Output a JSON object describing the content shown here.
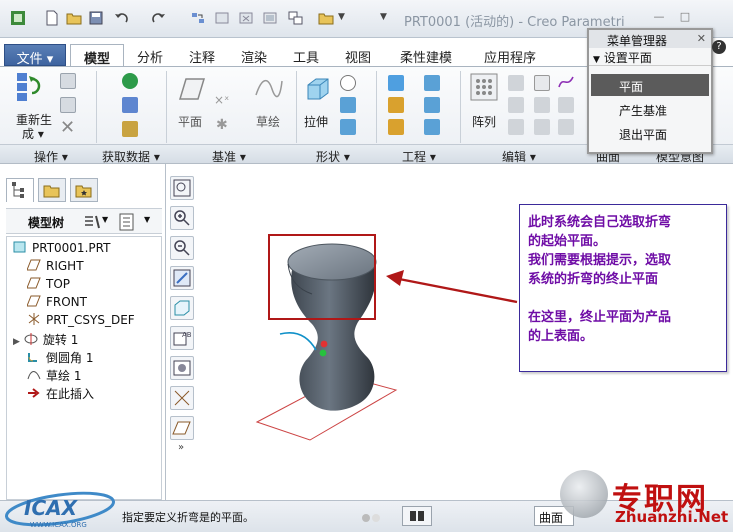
{
  "window": {
    "title": "PRT0001 (活动的) - Creo Parametri"
  },
  "tabs": [
    "文件 ▾",
    "模型",
    "分析",
    "注释",
    "渲染",
    "工具",
    "视图",
    "柔性建模",
    "应用程序"
  ],
  "ribbon": {
    "regen_label": "重新生",
    "regen_label2": "成 ▾",
    "plane_label": "平面",
    "sketch_label": "草绘",
    "extrude_label": "拉伸",
    "pattern_label": "阵列"
  },
  "groups": [
    "操作 ▾",
    "获取数据 ▾",
    "基准 ▾",
    "形状 ▾",
    "工程 ▾",
    "编辑 ▾",
    "曲面",
    "模型意图"
  ],
  "model_tree": {
    "header": "模型树",
    "items": [
      {
        "label": "PRT0001.PRT"
      },
      {
        "label": "RIGHT"
      },
      {
        "label": "TOP"
      },
      {
        "label": "FRONT"
      },
      {
        "label": "PRT_CSYS_DEF"
      },
      {
        "label": "旋转 1"
      },
      {
        "label": "倒圆角 1"
      },
      {
        "label": "草绘 1"
      },
      {
        "label": "在此插入"
      }
    ]
  },
  "menu_manager": {
    "title": "菜单管理器",
    "section": "设置平面",
    "items": [
      {
        "label": "平面",
        "selected": true
      },
      {
        "label": "产生基准",
        "selected": false
      },
      {
        "label": "退出平面",
        "selected": false
      }
    ]
  },
  "annotation": {
    "line1": "此时系统会自己选取折弯",
    "line2": "的起始平面。",
    "line3": "我们需要根据提示，选取",
    "line4": "系统的折弯的终止平面",
    "line5": "在这里，终止平面为产品",
    "line6": "的上表面。"
  },
  "status_bar": {
    "message": "指定要定义折弯是的平面。",
    "filter": "曲面"
  },
  "watermark": {
    "site": "专职网",
    "url": "Zhuanzhi.Net",
    "logo_text": "ICAX",
    "logo_url": "WWW.ICAX.ORG"
  },
  "colors": {
    "accent_red": "#b01818",
    "note_text": "#6f0da6",
    "note_border": "#3b2a9a",
    "model_gray": "#5d6670"
  }
}
